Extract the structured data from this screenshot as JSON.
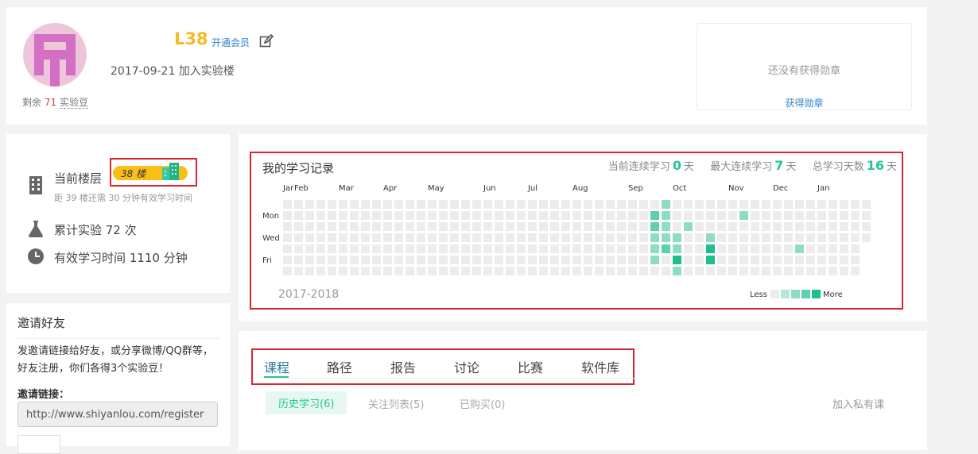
{
  "profile": {
    "level": "L38",
    "vip_label": "开通会员",
    "joined": "2017-09-21 加入实验楼",
    "beans_prefix": "剩余",
    "beans_count": "71",
    "beans_unit": "实验豆",
    "badge_empty": "还没有获得勋章",
    "badge_link": "获得勋章"
  },
  "stats": {
    "floor_label": "当前楼层",
    "floor_value": "38 楼",
    "floor_sub": "距 39 楼还需 30 分钟有效学习时间",
    "experiments": "累计实验 72 次",
    "study_time": "有效学习时间 1110 分钟"
  },
  "invite": {
    "title": "邀请好友",
    "desc": "发邀请链接给好友，或分享微博/QQ群等，好友注册，你们各得3个实验豆！",
    "link_label": "邀请链接：",
    "link_value": "http://www.shiyanlou.com/register"
  },
  "record": {
    "title": "我的学习记录",
    "current_streak_label": "当前连续学习",
    "current_streak": "0",
    "max_streak_label": "最大连续学习",
    "max_streak": "7",
    "total_label": "总学习天数",
    "total_days": "16",
    "day_unit": "天",
    "months": [
      "Jar",
      "Feb",
      "Mar",
      "Apr",
      "May",
      "Jun",
      "Jul",
      "Aug",
      "Sep",
      "Oct",
      "Nov",
      "Dec",
      "Jan"
    ],
    "weekdays": [
      "Mon",
      "Wed",
      "Fri"
    ],
    "year_range": "2017-2018",
    "legend_less": "Less",
    "legend_more": "More",
    "colors": {
      "empty": "#ececec",
      "levels": [
        "#ececec",
        "#b7e7d9",
        "#8fdcc4",
        "#5fcfae",
        "#1dbf8e"
      ]
    },
    "activity": [
      {
        "week": 33,
        "day": 1,
        "level": 3
      },
      {
        "week": 33,
        "day": 2,
        "level": 3
      },
      {
        "week": 33,
        "day": 3,
        "level": 2
      },
      {
        "week": 33,
        "day": 4,
        "level": 2
      },
      {
        "week": 33,
        "day": 5,
        "level": 2
      },
      {
        "week": 34,
        "day": 0,
        "level": 2
      },
      {
        "week": 34,
        "day": 1,
        "level": 2
      },
      {
        "week": 34,
        "day": 2,
        "level": 2
      },
      {
        "week": 34,
        "day": 3,
        "level": 2
      },
      {
        "week": 34,
        "day": 4,
        "level": 3
      },
      {
        "week": 35,
        "day": 3,
        "level": 2
      },
      {
        "week": 35,
        "day": 4,
        "level": 2
      },
      {
        "week": 35,
        "day": 5,
        "level": 4
      },
      {
        "week": 35,
        "day": 6,
        "level": 2
      },
      {
        "week": 36,
        "day": 2,
        "level": 2
      },
      {
        "week": 38,
        "day": 3,
        "level": 2
      },
      {
        "week": 38,
        "day": 4,
        "level": 4
      },
      {
        "week": 38,
        "day": 5,
        "level": 4
      },
      {
        "week": 41,
        "day": 1,
        "level": 2
      },
      {
        "week": 46,
        "day": 4,
        "level": 2
      }
    ]
  },
  "tabs": {
    "items": [
      "课程",
      "路径",
      "报告",
      "讨论",
      "比赛",
      "软件库"
    ],
    "subtabs": [
      "历史学习(6)",
      "关注列表(5)",
      "已购买(0)"
    ],
    "add_private": "加入私有课"
  }
}
